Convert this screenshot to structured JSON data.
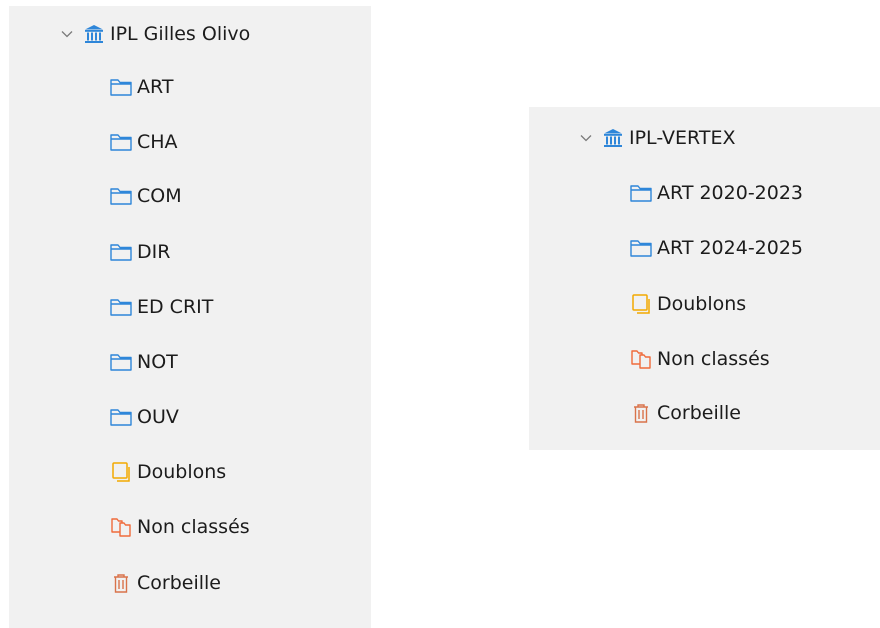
{
  "libraries": [
    {
      "name": "IPL Gilles Olivo",
      "icon": "library-icon",
      "expanded": true,
      "items": [
        {
          "label": "ART",
          "icon": "folder-icon"
        },
        {
          "label": "CHA",
          "icon": "folder-icon"
        },
        {
          "label": "COM",
          "icon": "folder-icon"
        },
        {
          "label": "DIR",
          "icon": "folder-icon"
        },
        {
          "label": "ED CRIT",
          "icon": "folder-icon"
        },
        {
          "label": "NOT",
          "icon": "folder-icon"
        },
        {
          "label": "OUV",
          "icon": "folder-icon"
        },
        {
          "label": "Doublons",
          "icon": "duplicates-icon"
        },
        {
          "label": "Non classés",
          "icon": "unfiled-icon"
        },
        {
          "label": "Corbeille",
          "icon": "trash-icon"
        }
      ]
    },
    {
      "name": "IPL-VERTEX",
      "icon": "library-icon",
      "expanded": true,
      "items": [
        {
          "label": "ART 2020-2023",
          "icon": "folder-icon"
        },
        {
          "label": "ART 2024-2025",
          "icon": "folder-icon"
        },
        {
          "label": "Doublons",
          "icon": "duplicates-icon"
        },
        {
          "label": "Non classés",
          "icon": "unfiled-icon"
        },
        {
          "label": "Corbeille",
          "icon": "trash-icon"
        }
      ]
    }
  ],
  "colors": {
    "library": "#2e86d9",
    "folder": "#2e86d9",
    "duplicates": "#f2a900",
    "unfiled": "#f06a3a",
    "trash": "#d9734a",
    "chevron": "#7a7a7a"
  }
}
